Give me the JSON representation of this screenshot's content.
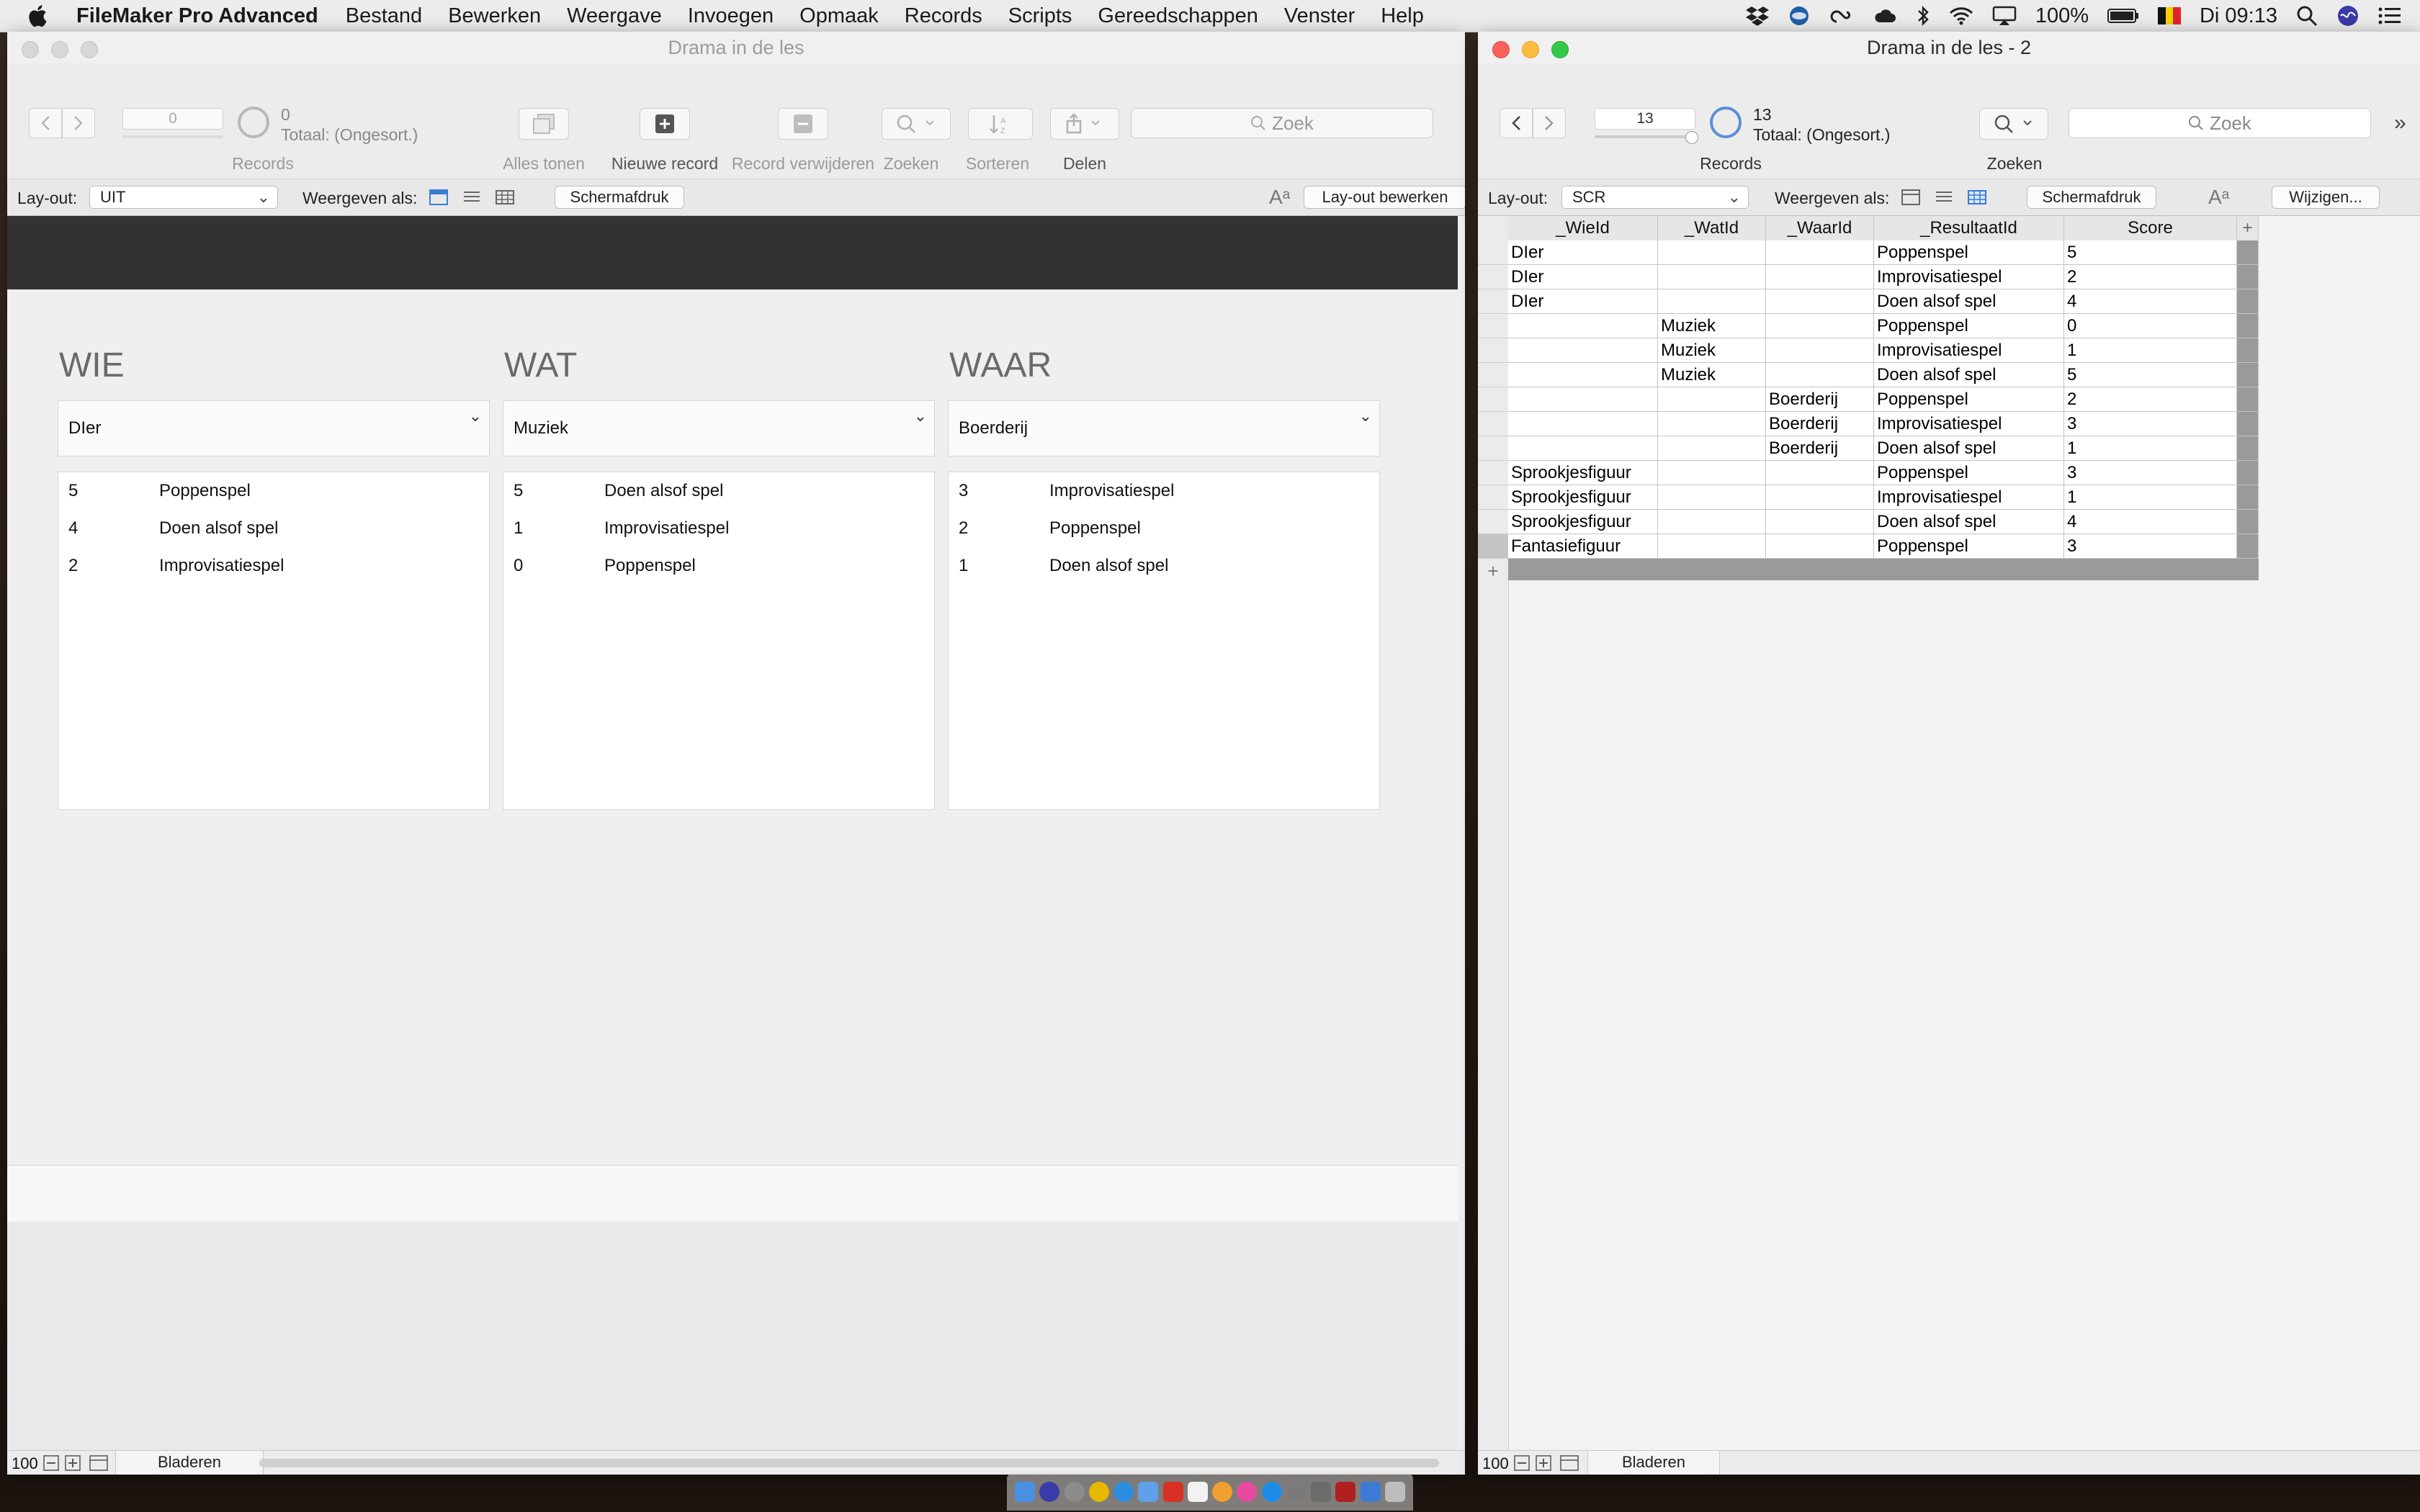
{
  "menubar": {
    "app_name": "FileMaker Pro Advanced",
    "items": [
      "Bestand",
      "Bewerken",
      "Weergave",
      "Invoegen",
      "Opmaak",
      "Records",
      "Scripts",
      "Gereedschappen",
      "Venster",
      "Help"
    ],
    "battery": "100%",
    "clock": "Di 09:13"
  },
  "left_window": {
    "title": "Drama in de les",
    "toolbar": {
      "record_number": "0",
      "record_count": "0",
      "total_label": "Totaal: (Ongesort.)",
      "records_label": "Records",
      "show_all_label": "Alles tonen",
      "new_record_label": "Nieuwe record",
      "delete_record_label": "Record verwijderen",
      "find_label": "Zoeken",
      "sort_label": "Sorteren",
      "share_label": "Delen",
      "search_placeholder": "Zoek"
    },
    "layoutbar": {
      "layout_label": "Lay-out:",
      "layout_value": "UIT",
      "view_as_label": "Weergeven als:",
      "print_button": "Schermafdruk",
      "edit_layout_button": "Lay-out bewerken"
    },
    "columns": [
      {
        "title": "WIE",
        "selected": "DIer",
        "rows": [
          {
            "num": "5",
            "text": "Poppenspel"
          },
          {
            "num": "4",
            "text": "Doen alsof spel"
          },
          {
            "num": "2",
            "text": "Improvisatiespel"
          }
        ]
      },
      {
        "title": "WAT",
        "selected": "Muziek",
        "rows": [
          {
            "num": "5",
            "text": "Doen alsof spel"
          },
          {
            "num": "1",
            "text": "Improvisatiespel"
          },
          {
            "num": "0",
            "text": "Poppenspel"
          }
        ]
      },
      {
        "title": "WAAR",
        "selected": "Boerderij",
        "rows": [
          {
            "num": "3",
            "text": "Improvisatiespel"
          },
          {
            "num": "2",
            "text": "Poppenspel"
          },
          {
            "num": "1",
            "text": "Doen alsof spel"
          }
        ]
      }
    ],
    "statusbar": {
      "zoom": "100",
      "mode": "Bladeren"
    }
  },
  "right_window": {
    "title": "Drama in de les - 2",
    "toolbar": {
      "record_number": "13",
      "record_count": "13",
      "total_label": "Totaal: (Ongesort.)",
      "records_label": "Records",
      "find_label": "Zoeken",
      "search_placeholder": "Zoek"
    },
    "layoutbar": {
      "layout_label": "Lay-out:",
      "layout_value": "SCR",
      "view_as_label": "Weergeven als:",
      "print_button": "Schermafdruk",
      "edit_button": "Wijzigen..."
    },
    "table": {
      "headers": [
        "_WieId",
        "_WatId",
        "_WaarId",
        "_ResultaatId",
        "Score"
      ],
      "rows": [
        [
          "DIer",
          "",
          "",
          "Poppenspel",
          "5"
        ],
        [
          "DIer",
          "",
          "",
          "Improvisatiespel",
          "2"
        ],
        [
          "DIer",
          "",
          "",
          "Doen alsof spel",
          "4"
        ],
        [
          "",
          "Muziek",
          "",
          "Poppenspel",
          "0"
        ],
        [
          "",
          "Muziek",
          "",
          "Improvisatiespel",
          "1"
        ],
        [
          "",
          "Muziek",
          "",
          "Doen alsof spel",
          "5"
        ],
        [
          "",
          "",
          "Boerderij",
          "Poppenspel",
          "2"
        ],
        [
          "",
          "",
          "Boerderij",
          "Improvisatiespel",
          "3"
        ],
        [
          "",
          "",
          "Boerderij",
          "Doen alsof spel",
          "1"
        ],
        [
          "Sprookjesfiguur",
          "",
          "",
          "Poppenspel",
          "3"
        ],
        [
          "Sprookjesfiguur",
          "",
          "",
          "Improvisatiespel",
          "1"
        ],
        [
          "Sprookjesfiguur",
          "",
          "",
          "Doen alsof spel",
          "4"
        ],
        [
          "Fantasiefiguur",
          "",
          "",
          "Poppenspel",
          "3"
        ]
      ]
    },
    "statusbar": {
      "zoom": "100",
      "mode": "Bladeren"
    }
  },
  "colors": {
    "dark_header": "#323232",
    "close": "#fc605b",
    "minimize": "#fdbc40",
    "maximize": "#34c84a",
    "accent_blue": "#3a7bd5"
  }
}
